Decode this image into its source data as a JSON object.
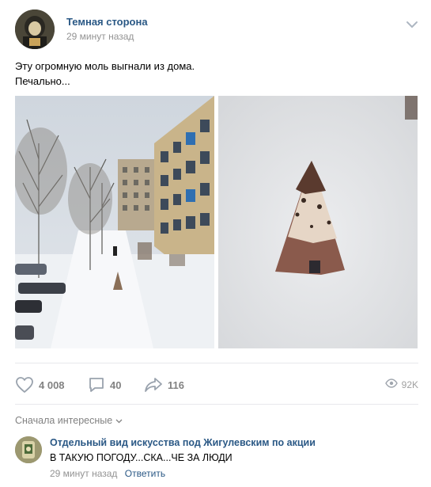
{
  "post": {
    "group_name": "Темная сторона",
    "time": "29 минут назад",
    "text_line1": "Эту огромную моль выгнали из дома.",
    "text_line2": "Печально..."
  },
  "actions": {
    "likes": "4 008",
    "comments": "40",
    "shares": "116",
    "views": "92K"
  },
  "comments_section": {
    "sort_label": "Сначала интересные"
  },
  "comment": {
    "author": "Отдельный вид искусства под Жигулевским по акции",
    "text": "В ТАКУЮ ПОГОДУ...СКА...ЧЕ ЗА ЛЮДИ",
    "time": "29 минут назад",
    "reply_label": "Ответить"
  },
  "colors": {
    "link": "#2a5885",
    "muted": "#939393",
    "action_icon": "#99a2ad"
  },
  "icons": [
    "chevron-down-icon",
    "heart-icon",
    "comment-icon",
    "share-icon",
    "eye-icon"
  ]
}
